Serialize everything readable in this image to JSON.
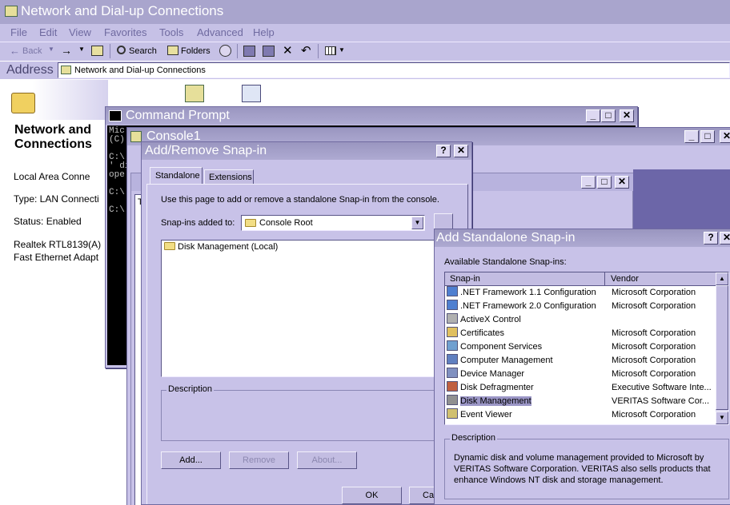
{
  "explorer": {
    "title": "Network and Dial-up Connections",
    "menu": [
      "File",
      "Edit",
      "View",
      "Favorites",
      "Tools",
      "Advanced",
      "Help"
    ],
    "toolbar": {
      "back": "Back",
      "search": "Search",
      "folders": "Folders"
    },
    "address_label": "Address",
    "address_value": "Network and Dial-up Connections",
    "panel_title": "Network and Connections",
    "details": [
      "Local Area Conne",
      "Type: LAN Connecti",
      "Status: Enabled",
      "Realtek RTL8139(A)",
      "Fast Ethernet Adapt"
    ]
  },
  "cmd": {
    "title": "Command Prompt",
    "lines": [
      "Mic",
      "(C)",
      "",
      "C:\\",
      "' di",
      "ope",
      "",
      "C:\\",
      "",
      "C:\\"
    ]
  },
  "console": {
    "title": "Console1",
    "tree_text": "T"
  },
  "add_remove": {
    "title": "Add/Remove Snap-in",
    "tabs": [
      "Standalone",
      "Extensions"
    ],
    "intro": "Use this page to add or remove a standalone Snap-in from the console.",
    "snapins_label": "Snap-ins added to:",
    "snapins_value": "Console Root",
    "items": [
      "Disk Management (Local)"
    ],
    "description_label": "Description",
    "buttons": {
      "add": "Add...",
      "remove": "Remove",
      "about": "About...",
      "ok": "OK",
      "cancel": "Ca"
    }
  },
  "add_standalone": {
    "title": "Add Standalone Snap-in",
    "available_label": "Available Standalone Snap-ins:",
    "columns": [
      "Snap-in",
      "Vendor"
    ],
    "rows": [
      {
        "name": ".NET Framework 1.1 Configuration",
        "vendor": "Microsoft Corporation",
        "icon_color": "#4f7fd0"
      },
      {
        "name": ".NET Framework 2.0 Configuration",
        "vendor": "Microsoft Corporation",
        "icon_color": "#4f7fd0"
      },
      {
        "name": "ActiveX Control",
        "vendor": "",
        "icon_color": "#b0b0b0"
      },
      {
        "name": "Certificates",
        "vendor": "Microsoft Corporation",
        "icon_color": "#e0c060"
      },
      {
        "name": "Component Services",
        "vendor": "Microsoft Corporation",
        "icon_color": "#70a0d0"
      },
      {
        "name": "Computer Management",
        "vendor": "Microsoft Corporation",
        "icon_color": "#6080c0"
      },
      {
        "name": "Device Manager",
        "vendor": "Microsoft Corporation",
        "icon_color": "#8090c0"
      },
      {
        "name": "Disk Defragmenter",
        "vendor": "Executive Software Inte...",
        "icon_color": "#c06040"
      },
      {
        "name": "Disk Management",
        "vendor": "VERITAS Software Cor...",
        "icon_color": "#909090"
      },
      {
        "name": "Event Viewer",
        "vendor": "Microsoft Corporation",
        "icon_color": "#d0c070"
      }
    ],
    "selected_index": 8,
    "description_label": "Description",
    "description": "Dynamic disk and volume management provided to Microsoft by VERITAS Software Corporation. VERITAS also sells products that enhance Windows NT disk and storage management."
  },
  "colors": {
    "title_active": "#8f8bb8",
    "dialog_face": "#c8c2e8",
    "desktop_accent": "#6c66a8"
  }
}
